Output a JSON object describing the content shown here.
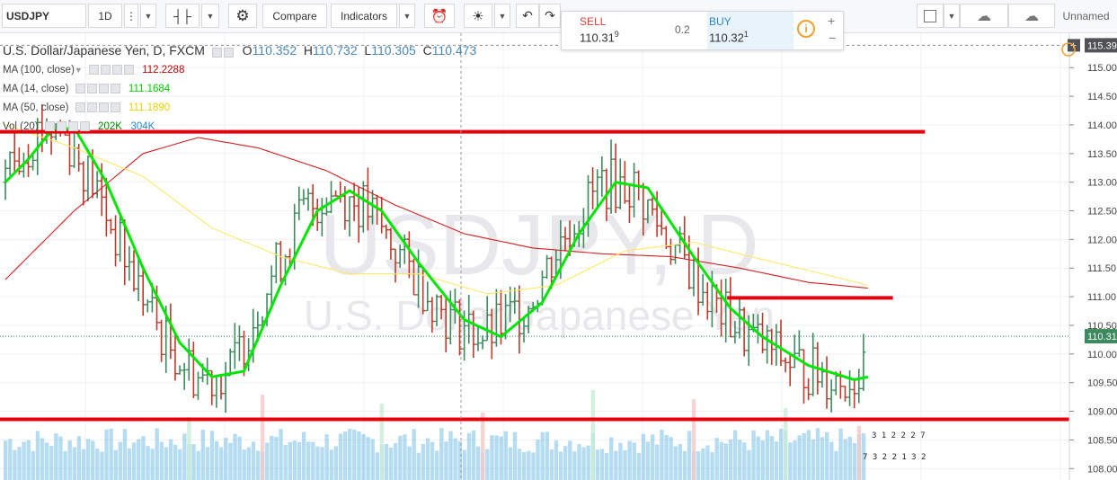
{
  "toolbar": {
    "symbol": "USDJPY",
    "interval": "1D",
    "compare_label": "Compare",
    "indicators_label": "Indicators",
    "layout_name": "Unnamed"
  },
  "trade_panel": {
    "sell_label": "SELL",
    "sell_price": "110.31",
    "sell_sup": "9",
    "spread": "0.2",
    "buy_label": "BUY",
    "buy_price": "110.32",
    "buy_sup": "1"
  },
  "legend": {
    "title": "U.S. Dollar/Japanese Yen, D, FXCM",
    "o_label": "O",
    "o_value": "110.352",
    "h_label": "H",
    "h_value": "110.732",
    "l_label": "L",
    "l_value": "110.305",
    "c_label": "C",
    "c_value": "110.473",
    "indicators": [
      {
        "name": "MA (100, close)",
        "value": "112.2288",
        "color": "#c00000"
      },
      {
        "name": "MA (14, close)",
        "value": "111.1684",
        "color": "#00cc00"
      },
      {
        "name": "MA (50, close)",
        "value": "111.1890",
        "color": "#ffee00"
      },
      {
        "name": "Vol (20)",
        "value": "202K",
        "value2": "304K",
        "color": "#008800",
        "color2": "#2e86c8"
      }
    ]
  },
  "watermark": {
    "symbol": "USDJPY, D",
    "name": "U.S. Dollar/Japanese Yen"
  },
  "colors": {
    "up": "#3d8a5e",
    "down": "#c0392b",
    "ma14": "#00e600",
    "ma50": "#ffe866",
    "ma100": "#d42020",
    "support": "#e8000b",
    "volume": "#78c0e6"
  },
  "chart_data": {
    "type": "ohlc",
    "ylim": [
      107.8,
      115.6
    ],
    "y_ticks": [
      "108.00",
      "108.50",
      "109.00",
      "109.50",
      "110.00",
      "110.50",
      "111.00",
      "111.50",
      "112.00",
      "112.50",
      "113.00",
      "113.50",
      "114.00",
      "114.50",
      "115.00"
    ],
    "top_price_label": "115.39",
    "last_price_label": "110.31",
    "last_price": 110.31,
    "horizontal_lines": [
      {
        "price": 113.88,
        "x_start": 0.0,
        "x_end": 0.865
      },
      {
        "price": 110.98,
        "x_start": 0.68,
        "x_end": 0.835
      },
      {
        "price": 108.86,
        "x_start": 0.0,
        "x_end": 1.0
      }
    ],
    "bar_count": 160,
    "ma14_path": [
      [
        0,
        113.0
      ],
      [
        5,
        113.4
      ],
      [
        10,
        113.9
      ],
      [
        15,
        113.95
      ],
      [
        22,
        113.0
      ],
      [
        30,
        111.5
      ],
      [
        38,
        110.2
      ],
      [
        45,
        109.6
      ],
      [
        52,
        109.7
      ],
      [
        60,
        111.2
      ],
      [
        68,
        112.5
      ],
      [
        75,
        112.85
      ],
      [
        82,
        112.5
      ],
      [
        90,
        111.6
      ],
      [
        100,
        110.6
      ],
      [
        108,
        110.3
      ],
      [
        117,
        110.9
      ],
      [
        125,
        112.1
      ],
      [
        133,
        113.0
      ],
      [
        140,
        112.9
      ],
      [
        150,
        111.7
      ],
      [
        158,
        110.8
      ],
      [
        165,
        110.3
      ],
      [
        175,
        109.8
      ],
      [
        185,
        109.55
      ],
      [
        188,
        109.6
      ]
    ],
    "ma50_path": [
      [
        0,
        114.0
      ],
      [
        15,
        113.6
      ],
      [
        30,
        113.1
      ],
      [
        45,
        112.2
      ],
      [
        60,
        111.7
      ],
      [
        75,
        111.4
      ],
      [
        90,
        111.4
      ],
      [
        105,
        111.05
      ],
      [
        120,
        111.2
      ],
      [
        135,
        111.8
      ],
      [
        150,
        111.95
      ],
      [
        165,
        111.65
      ],
      [
        178,
        111.4
      ],
      [
        188,
        111.2
      ]
    ],
    "ma100_path": [
      [
        0,
        111.3
      ],
      [
        15,
        112.5
      ],
      [
        30,
        113.5
      ],
      [
        42,
        113.78
      ],
      [
        55,
        113.6
      ],
      [
        70,
        113.2
      ],
      [
        85,
        112.6
      ],
      [
        100,
        112.1
      ],
      [
        115,
        111.85
      ],
      [
        130,
        111.75
      ],
      [
        145,
        111.7
      ],
      [
        160,
        111.5
      ],
      [
        175,
        111.25
      ],
      [
        188,
        111.15
      ]
    ],
    "volume_note": "volume bars along bottom"
  },
  "bottom_right_values": {
    "row1": "3 1 2 2 2 7",
    "row2": "7 3 2 2 1 3 2"
  }
}
